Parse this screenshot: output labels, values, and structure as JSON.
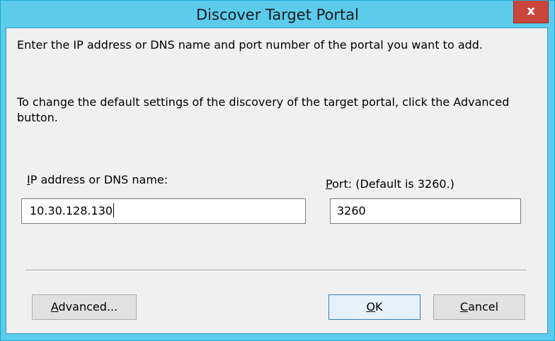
{
  "window": {
    "title": "Discover Target Portal",
    "close_glyph": "x",
    "colors": {
      "titlebar": "#5ccbec",
      "close_button": "#c9463d",
      "client_background": "#f0f0f0"
    }
  },
  "instructions": {
    "line1": "Enter the IP address or DNS name and port number of the portal you want to add.",
    "line2": "To change the default settings of the discovery of the target portal, click the Advanced button."
  },
  "ip_field": {
    "label_mnemonic": "I",
    "label_rest": "P address or DNS name:",
    "value": "10.30.128.130"
  },
  "port_field": {
    "label_mnemonic": "P",
    "label_rest": "ort: (Default is 3260.)",
    "value": "3260"
  },
  "buttons": {
    "advanced_mnemonic": "A",
    "advanced_rest": "dvanced...",
    "ok_mnemonic": "O",
    "ok_rest": "K",
    "cancel_mnemonic": "C",
    "cancel_rest": "ancel"
  }
}
